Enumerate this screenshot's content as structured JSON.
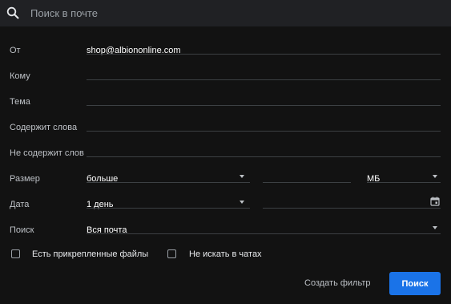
{
  "search": {
    "placeholder": "Поиск в почте"
  },
  "form": {
    "from": {
      "label": "От",
      "value": "shop@albiononline.com"
    },
    "to": {
      "label": "Кому",
      "value": ""
    },
    "subject": {
      "label": "Тема",
      "value": ""
    },
    "has_words": {
      "label": "Содержит слова",
      "value": ""
    },
    "no_words": {
      "label": "Не содержит слов",
      "value": ""
    },
    "size": {
      "label": "Размер",
      "comparator": "больше",
      "value": "",
      "unit": "МБ"
    },
    "date": {
      "label": "Дата",
      "range": "1 день",
      "value": ""
    },
    "search_in": {
      "label": "Поиск",
      "value": "Вся почта"
    }
  },
  "checkboxes": {
    "has_attachment": {
      "label": "Есть прикрепленные файлы",
      "checked": false
    },
    "exclude_chats": {
      "label": "Не искать в чатах",
      "checked": false
    }
  },
  "buttons": {
    "create_filter": "Создать фильтр",
    "search": "Поиск"
  },
  "colors": {
    "background": "#121212",
    "search_bar": "#202124",
    "accent": "#1a73e8",
    "divider": "#3c4043"
  }
}
